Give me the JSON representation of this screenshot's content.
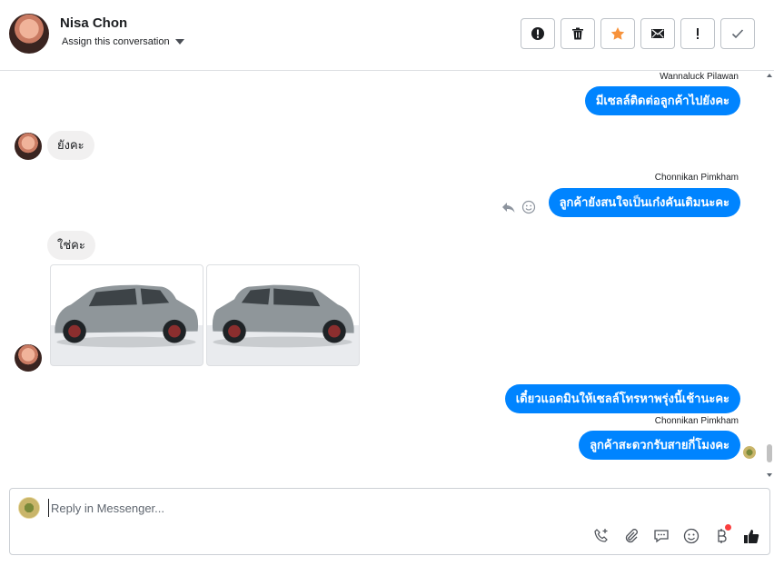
{
  "header": {
    "contact_name": "Nisa Chon",
    "assign_label": "Assign this conversation",
    "actions": [
      {
        "name": "spam-icon",
        "label": "Mark as spam"
      },
      {
        "name": "trash-icon",
        "label": "Delete"
      },
      {
        "name": "star-icon",
        "label": "Follow up"
      },
      {
        "name": "mail-icon",
        "label": "Mark as unread"
      },
      {
        "name": "exclamation-icon",
        "label": "Mark as priority"
      },
      {
        "name": "check-icon",
        "label": "Mark as done"
      }
    ],
    "accent_colors": {
      "star": "#f7923b",
      "bubble": "#0084ff"
    }
  },
  "messages": [
    {
      "direction": "out",
      "sender": "Wannaluck Pilawan",
      "text": "มีเซลล์ติดต่อลูกค้าไปยังคะ"
    },
    {
      "direction": "in",
      "text": "ยังคะ"
    },
    {
      "direction": "out",
      "sender": "Chonnikan Pimkham",
      "text": "ลูกค้ายังสนใจเป็นเก๋งคันเดิมนะคะ"
    },
    {
      "direction": "in",
      "text": "ใช่คะ",
      "attachments": [
        "car-photo-1",
        "car-photo-2"
      ]
    },
    {
      "direction": "out",
      "text": "เดี๋ยวแอดมินให้เซลล์โทรหาพรุ่งนี้เช้านะคะ"
    },
    {
      "direction": "out",
      "sender": "Chonnikan Pimkham",
      "text": "ลูกค้าสะดวกรับสายกี่โมงคะ"
    }
  ],
  "composer": {
    "placeholder": "Reply in Messenger...",
    "tools": [
      "phone-add-icon",
      "paperclip-icon",
      "saved-reply-icon",
      "emoji-icon",
      "baht-icon",
      "thumbs-up-icon"
    ]
  }
}
